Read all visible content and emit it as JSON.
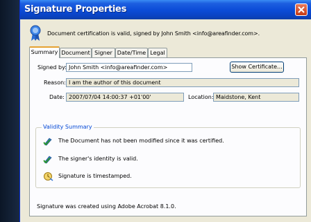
{
  "window": {
    "title": "Signature Properties"
  },
  "info": {
    "text": "Document certification is valid, signed by John Smith <info@areafinder.com>."
  },
  "tabs": [
    {
      "label": "Summary",
      "active": true
    },
    {
      "label": "Document",
      "active": false
    },
    {
      "label": "Signer",
      "active": false
    },
    {
      "label": "Date/Time",
      "active": false
    },
    {
      "label": "Legal",
      "active": false
    }
  ],
  "summary": {
    "signed_by_label": "Signed by:",
    "signed_by_value": "John Smith <info@areafinder.com>",
    "show_certificate_label": "Show Certificate...",
    "reason_label": "Reason:",
    "reason_value": "I am the author of this document",
    "date_label": "Date:",
    "date_value": "2007/07/04 14:00:37 +01'00'",
    "location_label": "Location:",
    "location_value": "Maidstone, Kent"
  },
  "validity": {
    "title": "Validity Summary",
    "items": [
      {
        "icon": "pen-check-icon",
        "text": "The Document has not been modified since it was certified."
      },
      {
        "icon": "pen-check-icon",
        "text": "The signer's identity is valid."
      },
      {
        "icon": "timestamp-icon",
        "text": "Signature is timestamped."
      }
    ]
  },
  "footer": {
    "text": "Signature was created using Adobe Acrobat 8.1.0."
  },
  "colors": {
    "titlebar": "#0b4bd6",
    "close_button": "#c63a14",
    "window_face": "#ece9d8",
    "group_title": "#0046d5"
  }
}
